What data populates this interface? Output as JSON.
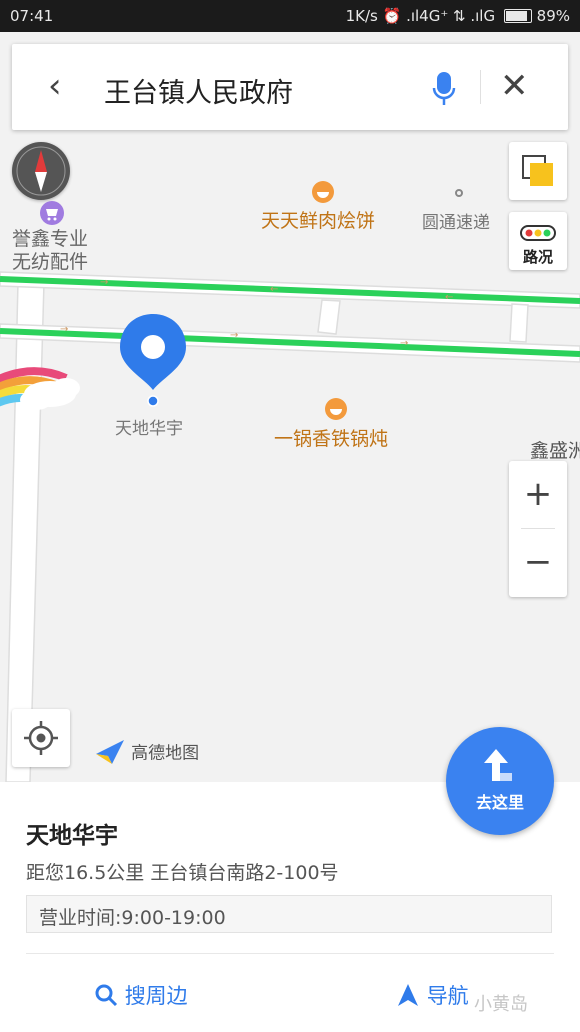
{
  "status_bar": {
    "time": "07:41",
    "right": "1K/s ⏰ .ıl4G⁺ ⇅ .ılG",
    "battery": "89%"
  },
  "search": {
    "query": "王台镇人民政府"
  },
  "map": {
    "pois": {
      "shop": "誉鑫专业\n无纺配件",
      "restaurant1": "天天鲜肉烩饼",
      "express": "圆通速递",
      "restaurant2": "一锅香铁锅炖",
      "right_edge": "鑫盛洲",
      "selected": "天地华宇"
    },
    "traffic_label": "路况",
    "zoom_in": "+",
    "zoom_out": "−",
    "logo": "高德地图"
  },
  "place": {
    "name": "天地华宇",
    "info": "距您16.5公里  王台镇台南路2-100号",
    "hours": "营业时间:9:00-19:00"
  },
  "actions": {
    "search_nearby": "搜周边",
    "navigate": "导航",
    "go_here": "去这里"
  },
  "watermark": "小黄岛",
  "colors": {
    "accent": "#3a82f0",
    "road_traffic": "#2bd15a",
    "poi_orange": "#c07417"
  }
}
